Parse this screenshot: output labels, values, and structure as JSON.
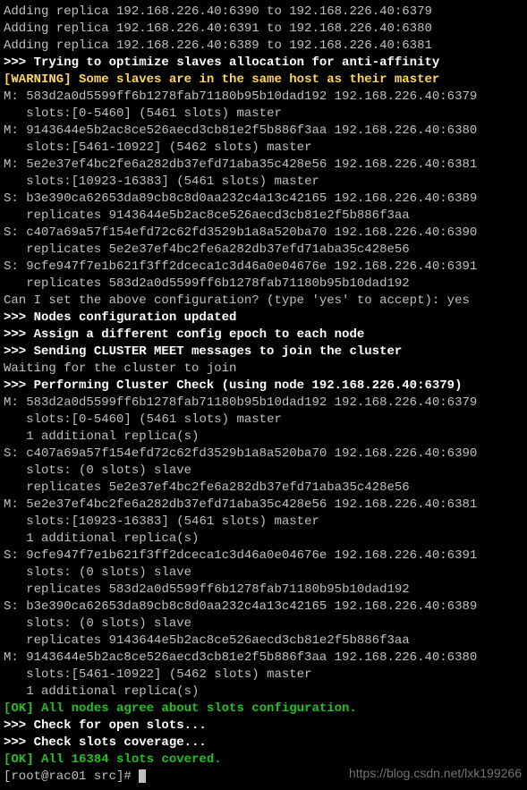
{
  "intro": [
    "Adding replica 192.168.226.40:6390 to 192.168.226.40:6379",
    "Adding replica 192.168.226.40:6391 to 192.168.226.40:6380",
    "Adding replica 192.168.226.40:6389 to 192.168.226.40:6381"
  ],
  "opt_line": ">>> Trying to optimize slaves allocation for anti-affinity",
  "warn_prefix": "[WARNING]",
  "warn_rest": " Some slaves are in the same host as their master",
  "nodes1": [
    "M: 583d2a0d5599ff6b1278fab71180b95b10dad192 192.168.226.40:6379",
    "   slots:[0-5460] (5461 slots) master",
    "M: 9143644e5b2ac8ce526aecd3cb81e2f5b886f3aa 192.168.226.40:6380",
    "   slots:[5461-10922] (5462 slots) master",
    "M: 5e2e37ef4bc2fe6a282db37efd71aba35c428e56 192.168.226.40:6381",
    "   slots:[10923-16383] (5461 slots) master",
    "S: b3e390ca62653da89cb8c8d0aa232c4a13c42165 192.168.226.40:6389",
    "   replicates 9143644e5b2ac8ce526aecd3cb81e2f5b886f3aa",
    "S: c407a69a57f154efd72c62fd3529b1a8a520ba70 192.168.226.40:6390",
    "   replicates 5e2e37ef4bc2fe6a282db37efd71aba35c428e56",
    "S: 9cfe947f7e1b621f3ff2dceca1c3d46a0e04676e 192.168.226.40:6391",
    "   replicates 583d2a0d5599ff6b1278fab71180b95b10dad192"
  ],
  "confirm": "Can I set the above configuration? (type 'yes' to accept): yes",
  "status1": ">>> Nodes configuration updated",
  "status2": ">>> Assign a different config epoch to each node",
  "status3": ">>> Sending CLUSTER MEET messages to join the cluster",
  "waiting": "Waiting for the cluster to join",
  "blank": "",
  "check_hdr": ">>> Performing Cluster Check (using node 192.168.226.40:6379)",
  "nodes2": [
    "M: 583d2a0d5599ff6b1278fab71180b95b10dad192 192.168.226.40:6379",
    "   slots:[0-5460] (5461 slots) master",
    "   1 additional replica(s)",
    "S: c407a69a57f154efd72c62fd3529b1a8a520ba70 192.168.226.40:6390",
    "   slots: (0 slots) slave",
    "   replicates 5e2e37ef4bc2fe6a282db37efd71aba35c428e56",
    "M: 5e2e37ef4bc2fe6a282db37efd71aba35c428e56 192.168.226.40:6381",
    "   slots:[10923-16383] (5461 slots) master",
    "   1 additional replica(s)",
    "S: 9cfe947f7e1b621f3ff2dceca1c3d46a0e04676e 192.168.226.40:6391",
    "   slots: (0 slots) slave",
    "   replicates 583d2a0d5599ff6b1278fab71180b95b10dad192",
    "S: b3e390ca62653da89cb8c8d0aa232c4a13c42165 192.168.226.40:6389",
    "   slots: (0 slots) slave",
    "   replicates 9143644e5b2ac8ce526aecd3cb81e2f5b886f3aa",
    "M: 9143644e5b2ac8ce526aecd3cb81e2f5b886f3aa 192.168.226.40:6380",
    "   slots:[5461-10922] (5462 slots) master",
    "   1 additional replica(s)"
  ],
  "ok1": "[OK] All nodes agree about slots configuration.",
  "chk1": ">>> Check for open slots...",
  "chk2": ">>> Check slots coverage...",
  "ok2": "[OK] All 16384 slots covered.",
  "prompt": "[root@rac01 src]# ",
  "watermark": "https://blog.csdn.net/lxk199266"
}
